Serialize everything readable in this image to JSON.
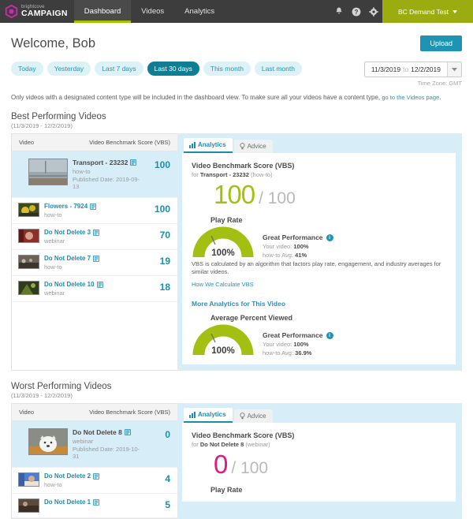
{
  "nav": {
    "brand_top": "brightcove",
    "brand_bottom": "CAMPAIGN",
    "items": [
      {
        "label": "Dashboard",
        "active": true
      },
      {
        "label": "Videos",
        "active": false
      },
      {
        "label": "Analytics",
        "active": false
      }
    ],
    "icons": [
      "bell-icon",
      "help-icon",
      "gear-icon"
    ],
    "account": "BC Demand Test"
  },
  "header": {
    "title": "Welcome, Bob",
    "upload_label": "Upload"
  },
  "filters": {
    "pills": [
      {
        "label": "Today",
        "active": false
      },
      {
        "label": "Yesterday",
        "active": false
      },
      {
        "label": "Last 7 days",
        "active": false
      },
      {
        "label": "Last 30 days",
        "active": true
      },
      {
        "label": "This month",
        "active": false
      },
      {
        "label": "Last month",
        "active": false
      }
    ],
    "date_start": "11/3/2019",
    "date_join": "to",
    "date_end": "12/2/2019",
    "timezone": "Time Zone: GMT"
  },
  "notice": {
    "text": "Only videos with a designated content type will be included in the dashboard view. To make sure all your videos have a content type, ",
    "link": "go to the Videos page",
    "tail": "."
  },
  "best": {
    "title": "Best Performing Videos",
    "subtitle": "(11/3/2019 - 12/2/2019)",
    "col_video": "Video",
    "col_score": "Video Benchmark Score (VBS)",
    "rows": [
      {
        "name": "Transport - 23232",
        "type": "how-to",
        "published": "Published Date: 2019-09-13",
        "score": "100",
        "selected": true
      },
      {
        "name": "Flowers - 7924",
        "type": "how-to",
        "published": "",
        "score": "100",
        "selected": false
      },
      {
        "name": "Do Not Delete 3",
        "type": "webinar",
        "published": "",
        "score": "70",
        "selected": false
      },
      {
        "name": "Do Not Delete 7",
        "type": "how-to",
        "published": "",
        "score": "19",
        "selected": false
      },
      {
        "name": "Do Not Delete 10",
        "type": "webinar",
        "published": "",
        "score": "18",
        "selected": false
      }
    ],
    "detail": {
      "tabs": [
        {
          "label": "Analytics",
          "icon": "bar-chart-icon",
          "active": true
        },
        {
          "label": "Advice",
          "icon": "lightbulb-icon",
          "active": false
        }
      ],
      "card_title": "Video Benchmark Score (VBS)",
      "for_prefix": "for",
      "for_video": "Transport - 23232",
      "for_type": "(how-to)",
      "score": "100",
      "score_max": "/ 100",
      "metrics": [
        {
          "label": "Play Rate",
          "value": "100%",
          "arc_pct": 100,
          "perf_title": "Great Performance",
          "your_video_label": "Your video:",
          "your_video_value": "100%",
          "avg_label": "how-to Avg:",
          "avg_value": "41%"
        },
        {
          "label": "Average Percent Viewed",
          "value": "100%",
          "arc_pct": 100,
          "perf_title": "Great Performance",
          "your_video_label": "Your video:",
          "your_video_value": "100%",
          "avg_label": "how-to Avg:",
          "avg_value": "36.9%"
        }
      ],
      "vbs_note": "VBS is calculated by an algorithm that factors play rate, engagement, and industry averages for similar videos.",
      "calc_link": "How We Calculate VBS",
      "more_link": "More Analytics for This Video"
    }
  },
  "worst": {
    "title": "Worst Performing Videos",
    "subtitle": "(11/3/2019 - 12/2/2019)",
    "col_video": "Video",
    "col_score": "Video Benchmark Score (VBS)",
    "rows": [
      {
        "name": "Do Not Delete 8",
        "type": "webinar",
        "published": "Published Date: 2019-10-31",
        "score": "0",
        "selected": true
      },
      {
        "name": "Do Not Delete 2",
        "type": "how-to",
        "published": "",
        "score": "4",
        "selected": false
      },
      {
        "name": "Do Not Delete 1",
        "type": "",
        "published": "",
        "score": "5",
        "selected": false
      }
    ],
    "detail": {
      "tabs": [
        {
          "label": "Analytics",
          "icon": "bar-chart-icon",
          "active": true
        },
        {
          "label": "Advice",
          "icon": "lightbulb-icon",
          "active": false
        }
      ],
      "card_title": "Video Benchmark Score (VBS)",
      "for_prefix": "for",
      "for_video": "Do Not Delete 8",
      "for_type": "(webinar)",
      "score": "0",
      "score_max": "/ 100",
      "metric_label": "Play Rate"
    }
  },
  "colors": {
    "brand_magenta": "#cc2bb0",
    "accent_teal": "#1c8dad",
    "accent_olive": "#a3bf12",
    "account_green": "#9aac10",
    "bad_pink": "#e2197e",
    "panel_blue": "#d7edf8"
  }
}
